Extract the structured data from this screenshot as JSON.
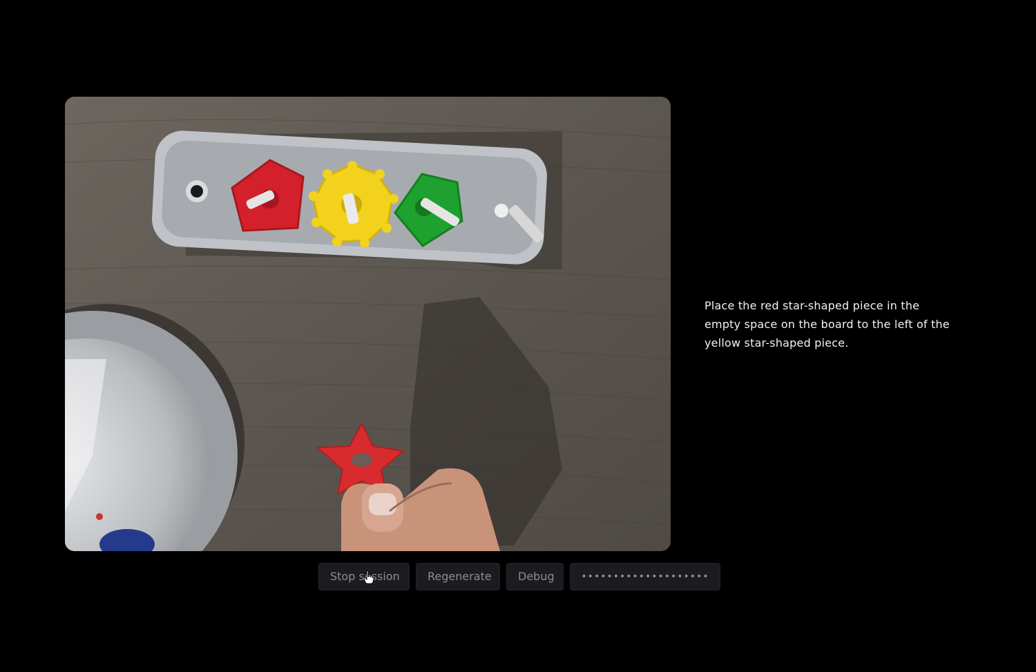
{
  "camera_feed": {
    "image_description_icon": "camera-feed-image"
  },
  "instruction": {
    "text": "Place the red star-shaped piece in the empty space on the board to the left of the yellow star-shaped piece."
  },
  "controls": {
    "stop_label": "Stop session",
    "regenerate_label": "Regenerate",
    "debug_label": "Debug",
    "api_key_masked": "••••••••••••••••••••"
  },
  "colors": {
    "background": "#000000",
    "button_bg": "#1b1c1f",
    "button_text": "#8b8d92",
    "instruction_text": "#f2f2f2"
  }
}
